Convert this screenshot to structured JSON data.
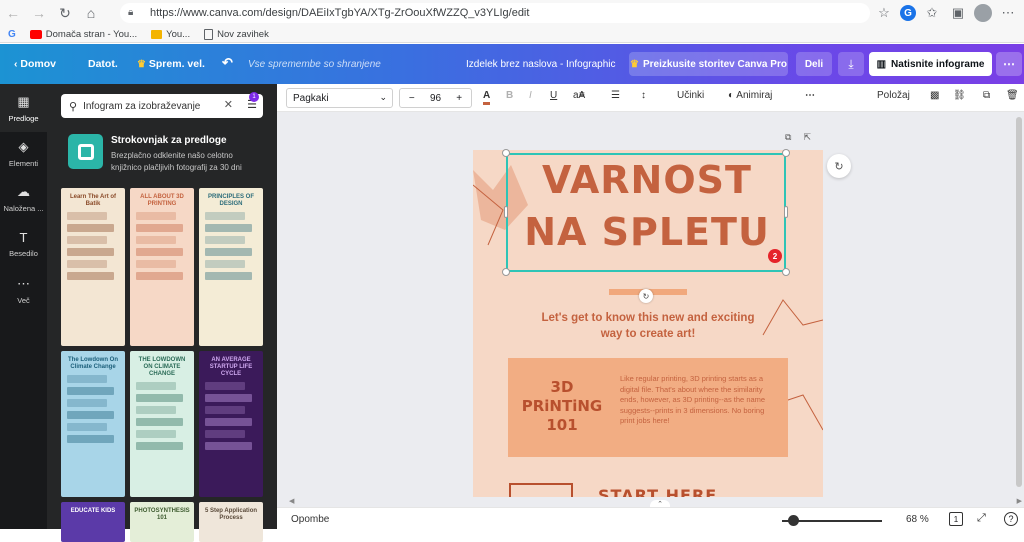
{
  "browser": {
    "url": "https://www.canva.com/design/DAEiIxTgbYA/XTg-ZrOouXfWZZQ_v3YLIg/edit",
    "bookmarks": [
      {
        "label": "G",
        "icon": "google-icon"
      },
      {
        "label": "Domača stran - You...",
        "icon": "youtube-icon"
      },
      {
        "label": "You...",
        "icon": "folder-icon"
      },
      {
        "label": "Nov zavihek",
        "icon": "page-icon"
      }
    ],
    "profile_initial": "G"
  },
  "topbar": {
    "home": "Domov",
    "file": "Datot.",
    "resize": "Sprem. vel.",
    "saved_status": "Vse spremembe so shranjene",
    "title": "Izdelek brez naslova - Infographic",
    "premium_button": "Preizkusite storitev Canva Pro",
    "share_button": "Deli",
    "print_button": "Natisnite infograme"
  },
  "rail": {
    "items": [
      {
        "label": "Predloge",
        "icon": "templates-icon"
      },
      {
        "label": "Elementi",
        "icon": "elements-icon"
      },
      {
        "label": "Naložena ...",
        "icon": "upload-icon"
      },
      {
        "label": "Besedilo",
        "icon": "text-icon"
      },
      {
        "label": "Več",
        "icon": "more-icon"
      }
    ]
  },
  "panel": {
    "search_value": "Infogram za izobraževanje",
    "filter_badge": "1",
    "promo_title": "Strokovnjak za predloge",
    "promo_text": "Brezplačno odklenite našo celotno knjižnico plačljivih fotografij za 30 dni",
    "thumbnails": [
      {
        "title": "Learn The Art of Batik",
        "bg": "#f3e6d3",
        "fg": "#8a4b2a"
      },
      {
        "title": "ALL ABOUT 3D PRINTING",
        "bg": "#f6d8c6",
        "fg": "#c4623f"
      },
      {
        "title": "PRINCIPLES OF DESIGN",
        "bg": "#f4ecd6",
        "fg": "#2b6c7a"
      },
      {
        "title": "The Lowdown On Climate Change",
        "bg": "#a8d5e8",
        "fg": "#1c5f7a"
      },
      {
        "title": "THE LOWDOWN ON CLIMATE CHANGE",
        "bg": "#d8efe4",
        "fg": "#2a6b57"
      },
      {
        "title": "AN AVERAGE STARTUP LIFE CYCLE",
        "bg": "#3b1a5a",
        "fg": "#cfa8f0"
      },
      {
        "title": "EDUCATE KIDS",
        "bg": "#5b3aa8",
        "fg": "#ffffff"
      },
      {
        "title": "PHOTOSYNTHESIS 101",
        "bg": "#e4eed8",
        "fg": "#3d5b2f"
      },
      {
        "title": "5 Step Application Process",
        "bg": "#efe6da",
        "fg": "#5a4a3a"
      }
    ]
  },
  "toolbar": {
    "font": "Pagkaki",
    "font_size": "96",
    "effects": "Učinki",
    "animate": "Animiraj",
    "position": "Položaj"
  },
  "canvas": {
    "headline_line1": "VARNOST",
    "headline_line2": "NA SPLETU",
    "selection_badge": "2",
    "subhead": "Let's get to know this new and exciting way to create art!",
    "card_title": "3D PRiNTiNG 101",
    "card_text": "Like regular printing, 3D printing starts as a digital file. That's about where the similarity ends, however, as 3D printing--as the name suggests--prints in 3 dimensions. No boring print jobs here!",
    "start_text": "START HERE"
  },
  "bottombar": {
    "notes": "Opombe",
    "zoom": "68 %",
    "page_number": "1",
    "zoom_fraction": 0.11
  },
  "colors": {
    "brand_gradient_start": "#1c93d3",
    "brand_gradient_end": "#7a3fe6",
    "accent_purple": "#7d2ae8",
    "headline": "#c4623f",
    "page_bg": "#f6d8c6"
  }
}
